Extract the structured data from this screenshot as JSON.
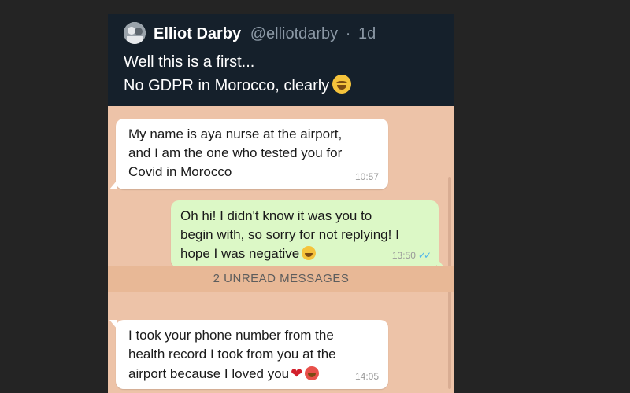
{
  "tweet": {
    "author_name": "Elliot Darby",
    "author_handle": "@elliotdarby",
    "separator": "·",
    "age": "1d",
    "text_line_1": "Well this is a first...",
    "text_line_2": "No GDPR in Morocco, clearly",
    "text_emoji": "rolling-on-floor-laughing-icon"
  },
  "chat": {
    "messages": [
      {
        "direction": "incoming",
        "lines": [
          "My name is aya nurse at the airport,",
          "and I am the one who tested you for",
          "Covid in Morocco"
        ],
        "time": "10:57"
      },
      {
        "direction": "outgoing",
        "lines": [
          "Oh hi! I didn't know it was you to",
          "begin with, so sorry for not replying! I",
          "hope I was negative"
        ],
        "time": "13:50",
        "status": "read"
      },
      {
        "direction": "incoming",
        "lines": [
          "I took your phone number from the",
          "health record I took from you at the",
          "airport because I loved you"
        ],
        "time": "14:05"
      }
    ],
    "unread_banner": "2 UNREAD MESSAGES"
  },
  "colors": {
    "page_background": "#242424",
    "tweet_background": "#15202b",
    "chat_background": "#edc3a8",
    "incoming_bubble": "#ffffff",
    "outgoing_bubble": "#dcf8c6",
    "read_ticks": "#4fb6ec"
  }
}
